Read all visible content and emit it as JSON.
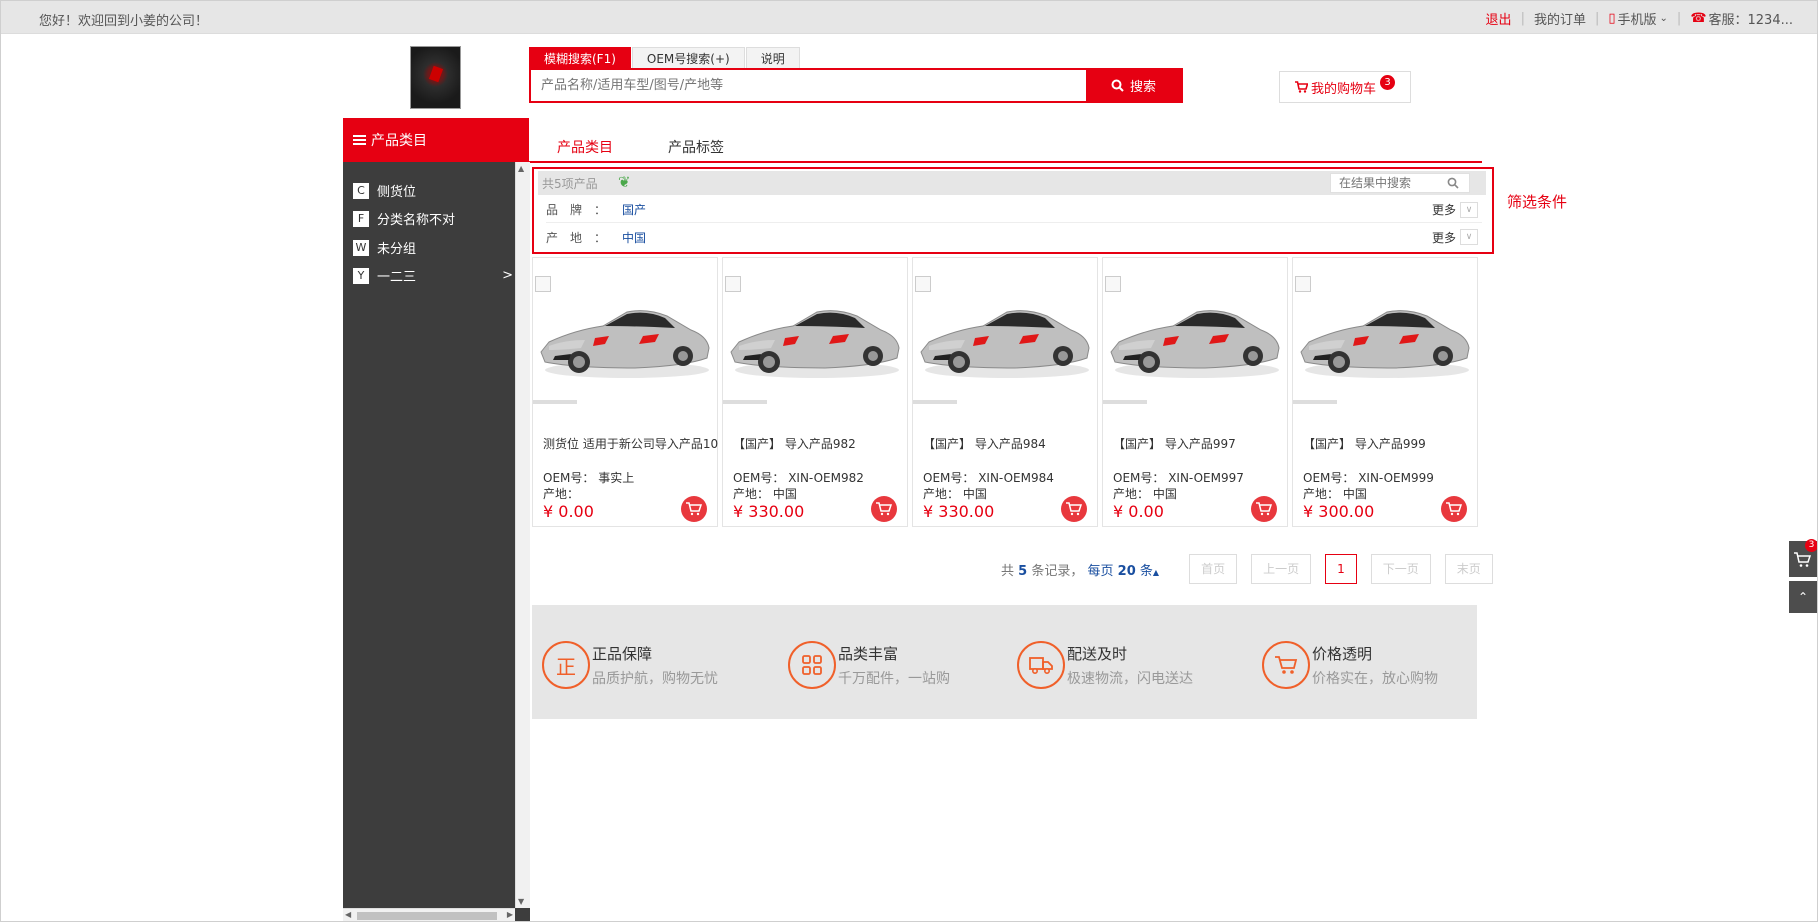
{
  "topbar": {
    "welcome": "您好！欢迎回到小姜的公司！",
    "logout": "退出",
    "my_orders": "我的订单",
    "mobile": "手机版",
    "service": "客服：1234..."
  },
  "search": {
    "tabs": [
      "模糊搜索(F1)",
      "OEM号搜索(+)",
      "说明"
    ],
    "placeholder": "产品名称/适用车型/图号/产地等",
    "button": "搜索"
  },
  "cart": {
    "label": "我的购物车",
    "count": "3"
  },
  "category_header": "产品类目",
  "main_tabs": [
    "产品类目",
    "产品标签"
  ],
  "sidebar": {
    "items": [
      {
        "letter": "C",
        "label": "侧货位",
        "arrow": ""
      },
      {
        "letter": "F",
        "label": "分类名称不对",
        "arrow": ""
      },
      {
        "letter": "W",
        "label": "未分组",
        "arrow": ""
      },
      {
        "letter": "Y",
        "label": "一二三",
        "arrow": ">"
      }
    ]
  },
  "filter": {
    "count": "共5项产品",
    "search_placeholder": "在结果中搜索",
    "rows": [
      {
        "label": "品牌：",
        "value": "国产",
        "more": "更多"
      },
      {
        "label": "产地：",
        "value": "中国",
        "more": "更多"
      }
    ],
    "annotation": "筛选条件"
  },
  "products": [
    {
      "name": "测货位 适用于新公司导入产品10",
      "oem": "OEM号： 事实上",
      "origin": "产地：",
      "price": "¥ 0.00"
    },
    {
      "name": "【国产】 导入产品982",
      "oem": "OEM号： XIN-OEM982",
      "origin": "产地： 中国",
      "price": "¥ 330.00"
    },
    {
      "name": "【国产】 导入产品984",
      "oem": "OEM号： XIN-OEM984",
      "origin": "产地： 中国",
      "price": "¥ 330.00"
    },
    {
      "name": "【国产】 导入产品997",
      "oem": "OEM号： XIN-OEM997",
      "origin": "产地： 中国",
      "price": "¥ 0.00"
    },
    {
      "name": "【国产】 导入产品999",
      "oem": "OEM号： XIN-OEM999",
      "origin": "产地： 中国",
      "price": "¥ 300.00"
    }
  ],
  "pager": {
    "prefix": "共",
    "total": "5",
    "suffix": "条记录，",
    "per_page_prefix": "每页",
    "per_page": "20",
    "per_page_suffix": "条",
    "first": "首页",
    "prev": "上一页",
    "current": "1",
    "next": "下一页",
    "last": "末页"
  },
  "services": [
    {
      "icon_char": "正",
      "icon": "genuine-icon",
      "title": "正品保障",
      "desc": "品质护航，购物无忧"
    },
    {
      "icon_char": "",
      "icon": "grid-icon",
      "title": "品类丰富",
      "desc": "千万配件，一站购"
    },
    {
      "icon_char": "",
      "icon": "truck-icon",
      "title": "配送及时",
      "desc": "极速物流，闪电送达"
    },
    {
      "icon_char": "",
      "icon": "cart-icon",
      "title": "价格透明",
      "desc": "价格实在，放心购物"
    }
  ],
  "float_cart_count": "3",
  "colors": {
    "accent": "#e60012",
    "sidebar": "#3d3d3d",
    "service_orange": "#f0602a",
    "link_blue": "#1a4fa0"
  }
}
